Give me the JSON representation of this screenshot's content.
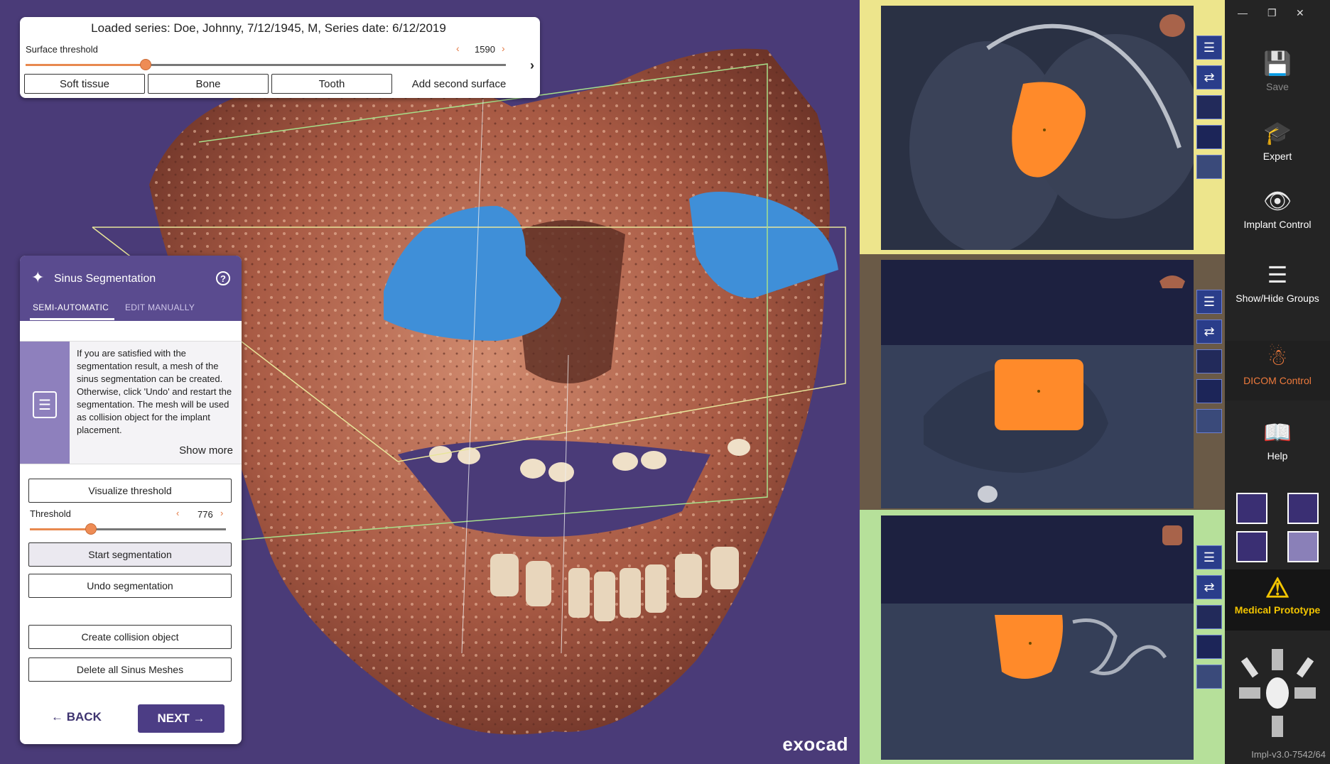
{
  "series_title": "Loaded series: Doe, Johnny, 7/12/1945, M, Series date: 6/12/2019",
  "surface": {
    "threshold_label": "Surface threshold",
    "threshold_value": "1590",
    "threshold_fraction": 0.25,
    "buttons": [
      "Soft tissue",
      "Bone",
      "Tooth",
      "Add second surface"
    ]
  },
  "sinus": {
    "title": "Sinus Segmentation",
    "tabs": [
      "SEMI-AUTOMATIC",
      "EDIT MANUALLY"
    ],
    "info_text": "If you are satisfied with the segmentation result, a mesh of the sinus segmentation can be created. Otherwise, click 'Undo' and restart the segmentation. The mesh will be used as collision object for the implant placement.",
    "show_more": "Show more",
    "visualize_threshold": "Visualize threshold",
    "threshold_label": "Threshold",
    "threshold_value": "776",
    "threshold_fraction": 0.31,
    "start_segmentation": "Start segmentation",
    "undo_segmentation": "Undo segmentation",
    "create_collision": "Create collision object",
    "delete_meshes": "Delete all Sinus Meshes",
    "back": "BACK",
    "next": "NEXT"
  },
  "brand": "exocad",
  "sidebar": {
    "items": [
      {
        "label": "Save",
        "icon": "save-icon"
      },
      {
        "label": "Expert",
        "icon": "graduation-cap-icon"
      },
      {
        "label": "Implant Control",
        "icon": "implant-eye-icon"
      },
      {
        "label": "Show/Hide Groups",
        "icon": "groups-eye-icon"
      },
      {
        "label": "DICOM Control",
        "icon": "dicom-jaw-icon"
      },
      {
        "label": "Help",
        "icon": "help-book-icon"
      }
    ],
    "medical_prototype": "Medical Prototype",
    "version": "Impl-v3.0-7542/64"
  },
  "colors": {
    "viewport_bg": "#4a3b78",
    "sinus_mesh": "#3f8fd8",
    "segmentation": "#ff8a2a",
    "frame_top": "#ede58c",
    "frame_middle": "#6a5a47",
    "frame_bottom": "#b6e09a",
    "accent": "#ee7a3c"
  }
}
